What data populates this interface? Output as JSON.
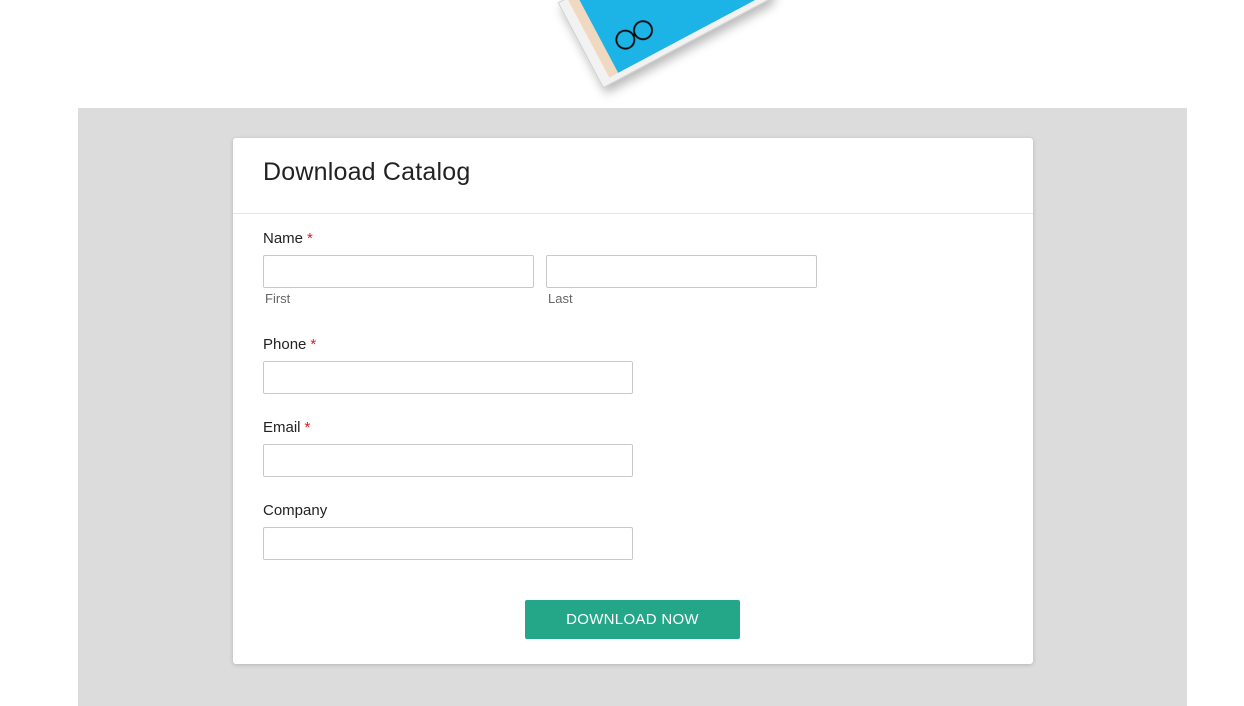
{
  "form": {
    "title": "Download Catalog",
    "required_marker": "*",
    "fields": {
      "name": {
        "label": "Name",
        "first": {
          "value": "",
          "sublabel": "First"
        },
        "last": {
          "value": "",
          "sublabel": "Last"
        }
      },
      "phone": {
        "label": "Phone",
        "value": ""
      },
      "email": {
        "label": "Email",
        "value": ""
      },
      "company": {
        "label": "Company",
        "value": ""
      }
    },
    "submit_label": "DOWNLOAD NOW"
  },
  "colors": {
    "band_background": "#dcdcdc",
    "button": "#24a788",
    "required": "#e01b1b",
    "catalog_cover": "#1fb4e6"
  }
}
